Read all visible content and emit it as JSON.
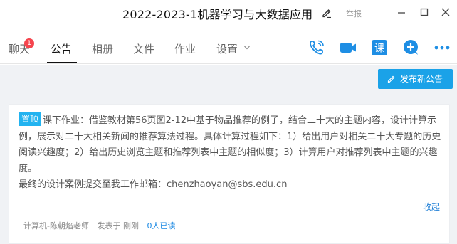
{
  "window": {
    "title": "2022-2023-1机器学习与大数据应用",
    "report_label": "举报"
  },
  "tabs": [
    {
      "label": "聊天",
      "badge": "1"
    },
    {
      "label": "公告"
    },
    {
      "label": "相册"
    },
    {
      "label": "文件"
    },
    {
      "label": "作业"
    },
    {
      "label": "设置"
    }
  ],
  "toolbar_icons": [
    "phone-icon",
    "video-icon",
    "class-icon",
    "add-icon",
    "more-icon"
  ],
  "class_icon_char": "课",
  "publish_button": "发布新公告",
  "announcement": {
    "pin_label": "置顶",
    "body": "课下作业：借鉴教材第56页图2-12中基于物品推荐的例子，结合二十大的主题内容，设计计算示例，展示对二十大相关新闻的推荐算法过程。具体计算过程如下：1）给出用户对相关二十大专题的历史阅读兴趣度；2）给出历史浏览主题和推荐列表中主题的相似度；3）计算用户对推荐列表中主题的兴趣度。",
    "email_line": "最终的设计案例提交至我工作邮箱：chenzhaoyan@sbs.edu.cn",
    "collapse_label": "收起",
    "author": "计算机-陈朝焰老师",
    "posted": "发表于 刚刚",
    "read_count": "0人已读"
  },
  "colors": {
    "accent": "#1aa2e8",
    "pin": "#22b3f0",
    "link": "#1f7fd6",
    "badge": "#f5454e",
    "icon_blue": "#1e8ee4"
  }
}
